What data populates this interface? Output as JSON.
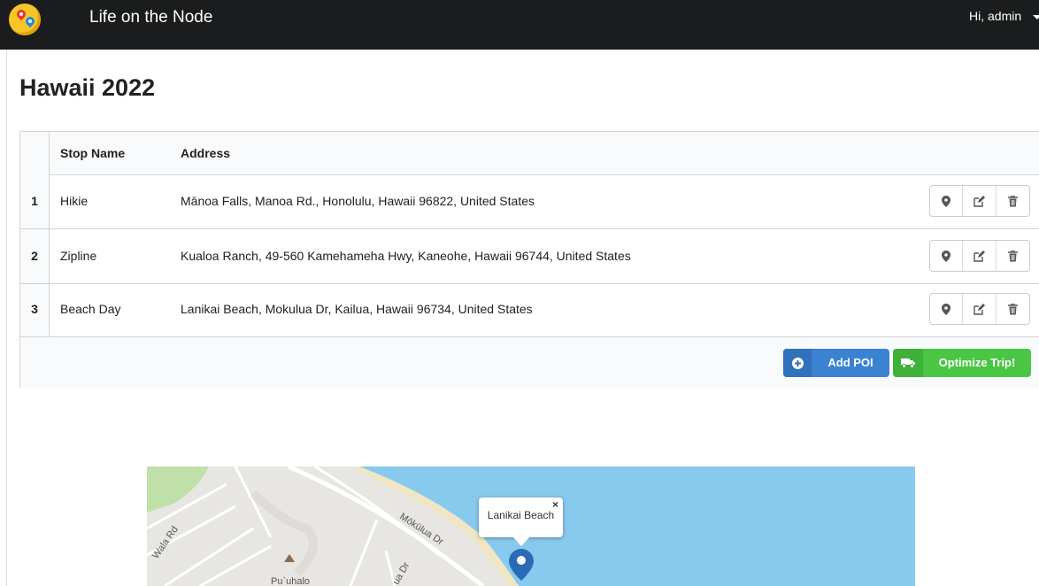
{
  "header": {
    "brand": "Life on the Node",
    "greeting": "Hi, admin"
  },
  "page": {
    "title": "Hawaii 2022"
  },
  "table": {
    "columns": [
      "Stop Name",
      "Address"
    ],
    "rows": [
      {
        "num": "1",
        "name": "Hikie",
        "address": "Mānoa Falls, Manoa Rd., Honolulu, Hawaii 96822, United States"
      },
      {
        "num": "2",
        "name": "Zipline",
        "address": "Kualoa Ranch, 49-560 Kamehameha Hwy, Kaneohe, Hawaii 96744, United States"
      },
      {
        "num": "3",
        "name": "Beach Day",
        "address": "Lanikai Beach, Mokulua Dr, Kailua, Hawaii 96734, United States"
      }
    ],
    "row_action_icons": [
      "map-marker-icon",
      "edit-icon",
      "trash-icon"
    ]
  },
  "actions": {
    "add_poi": "Add POI",
    "optimize": "Optimize Trip!"
  },
  "map": {
    "popup_label": "Lanikai Beach",
    "popup_close": "×",
    "street_labels": [
      "Mōkūlua Dr",
      "Wala Rd",
      "ua Dr"
    ],
    "poi_label": "Pu`uhalo",
    "colors": {
      "water": "#88c9ee",
      "land": "#e8e6e2",
      "park": "#bfe0a8",
      "marker": "#2b6ab5"
    }
  },
  "colors": {
    "topbar": "#1b1c1d",
    "primary_button": "#3b83d1",
    "success_button": "#4bc544"
  }
}
